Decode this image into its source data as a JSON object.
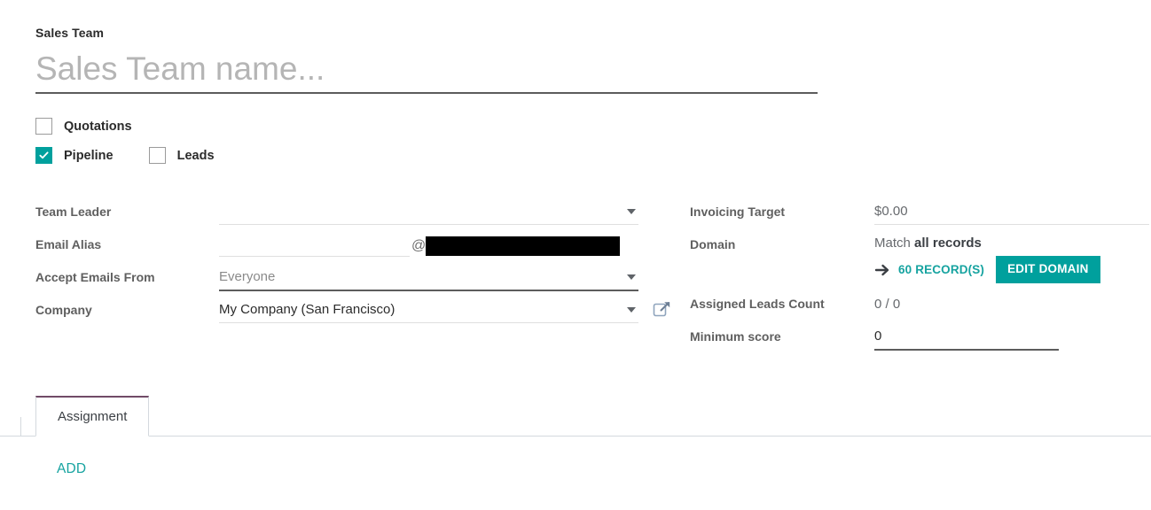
{
  "form": {
    "title_label": "Sales Team",
    "name_placeholder": "Sales Team name...",
    "name_value": ""
  },
  "options": {
    "quotations": {
      "label": "Quotations",
      "checked": false
    },
    "pipeline": {
      "label": "Pipeline",
      "checked": true
    },
    "leads": {
      "label": "Leads",
      "checked": false
    }
  },
  "left_fields": {
    "team_leader": {
      "label": "Team Leader",
      "value": ""
    },
    "email_alias": {
      "label": "Email Alias",
      "value": "",
      "at_symbol": "@",
      "domain_redacted": true
    },
    "accept_emails_from": {
      "label": "Accept Emails From",
      "value": "Everyone"
    },
    "company": {
      "label": "Company",
      "value": "My Company (San Francisco)"
    }
  },
  "right_fields": {
    "invoicing_target": {
      "label": "Invoicing Target",
      "value": "$0.00"
    },
    "domain": {
      "label": "Domain",
      "match_prefix": "Match",
      "match_value": "all records",
      "records_link": "60 RECORD(S)",
      "edit_button": "EDIT DOMAIN"
    },
    "assigned_leads_count": {
      "label": "Assigned Leads Count",
      "value": "0 / 0"
    },
    "minimum_score": {
      "label": "Minimum score",
      "value": "0"
    }
  },
  "notebook": {
    "tabs": [
      {
        "label": "Assignment",
        "active": true
      }
    ],
    "add_label": "ADD"
  },
  "colors": {
    "accent_teal": "#00a09d",
    "link_teal": "#16a3a0",
    "tab_active_purple": "#714b67",
    "label_gray": "#5f5f5f",
    "placeholder_gray": "#b5b5b5",
    "underline_dark": "#5c5c5c",
    "underline_light": "#dfdfdf",
    "redaction_black": "#000000"
  }
}
